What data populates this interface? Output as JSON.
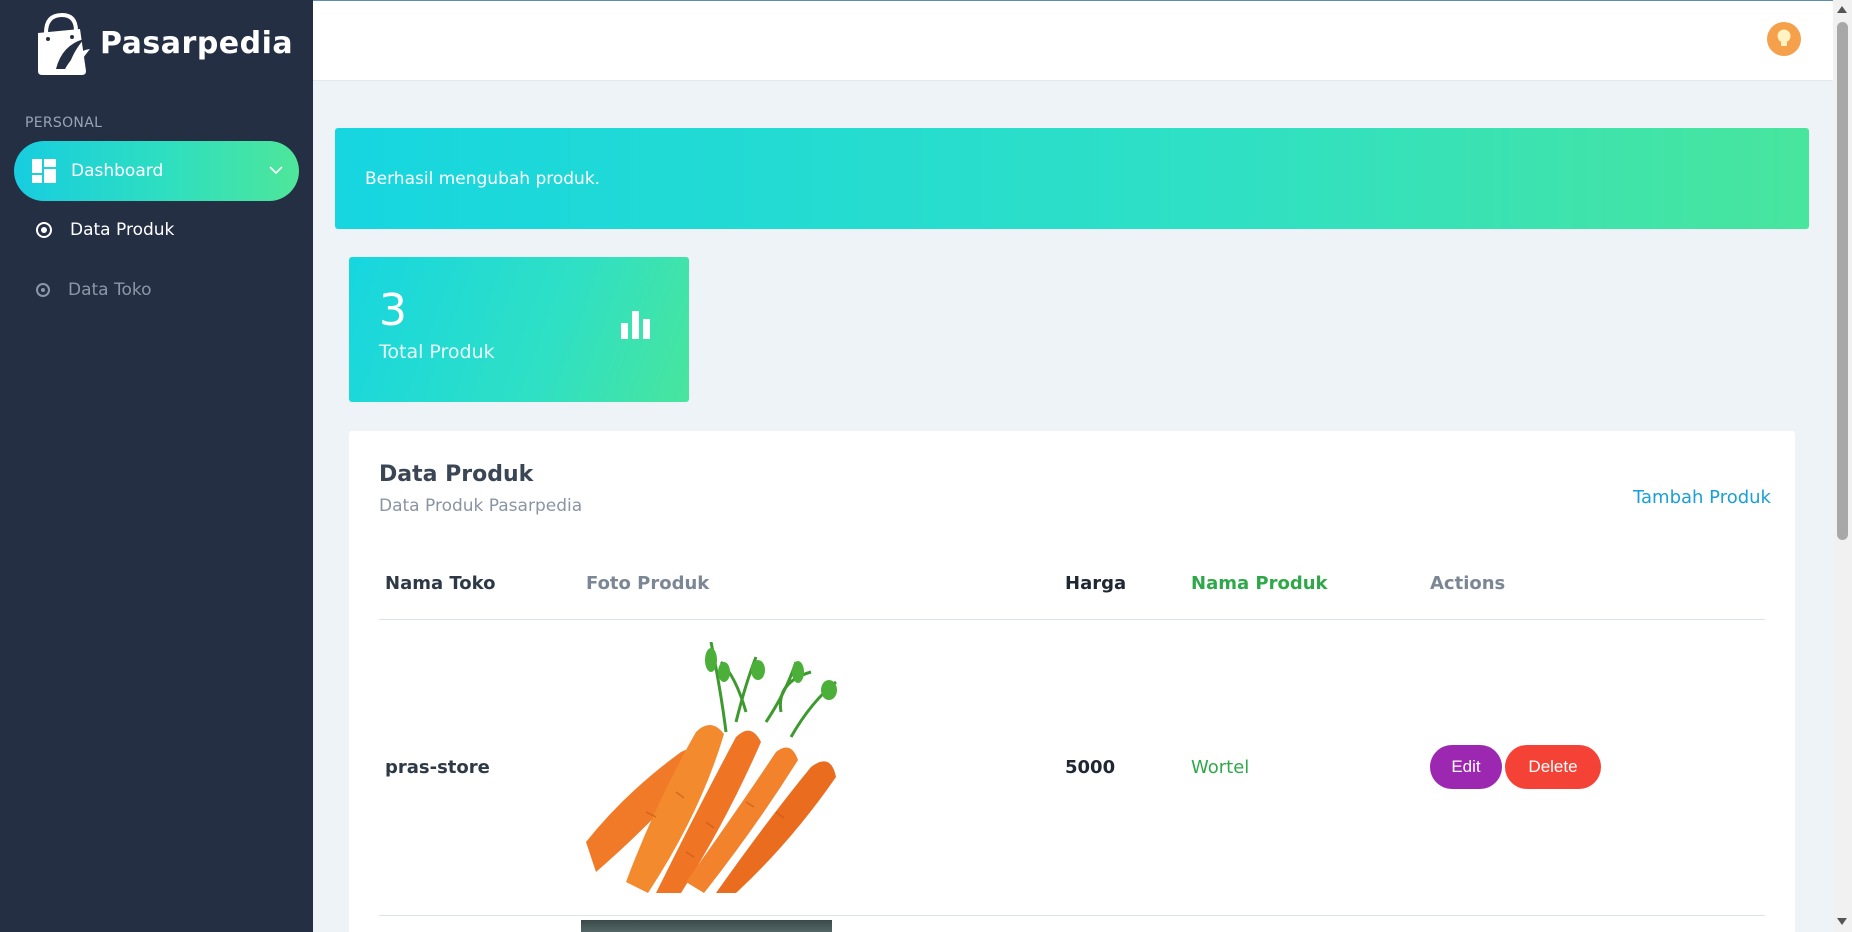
{
  "brand": {
    "name": "Pasarpedia"
  },
  "sidebar": {
    "section_label": "PERSONAL",
    "dashboard_label": "Dashboard",
    "items": [
      {
        "label": "Data Produk",
        "active": true
      },
      {
        "label": "Data Toko",
        "active": false
      }
    ]
  },
  "alert": {
    "message": "Berhasil mengubah produk."
  },
  "stat": {
    "value": "3",
    "caption": "Total Produk",
    "icon": "bar-chart-icon"
  },
  "card": {
    "title": "Data Produk",
    "subtitle": "Data Produk Pasarpedia",
    "add_link": "Tambah Produk"
  },
  "table": {
    "headers": [
      "Nama Toko",
      "Foto Produk",
      "Harga",
      "Nama Produk",
      "Actions"
    ],
    "rows": [
      {
        "toko": "pras-store",
        "foto": "carrot-image",
        "harga": "5000",
        "nama": "Wortel",
        "edit": "Edit",
        "delete": "Delete"
      }
    ]
  },
  "colors": {
    "sidebar_bg": "#252f44",
    "accent_start": "#17d6e0",
    "accent_end": "#48e59d",
    "edit_button": "#9c27b0",
    "delete_button": "#f44336",
    "product_name": "#2fa84a",
    "link": "#1a9fd8"
  }
}
